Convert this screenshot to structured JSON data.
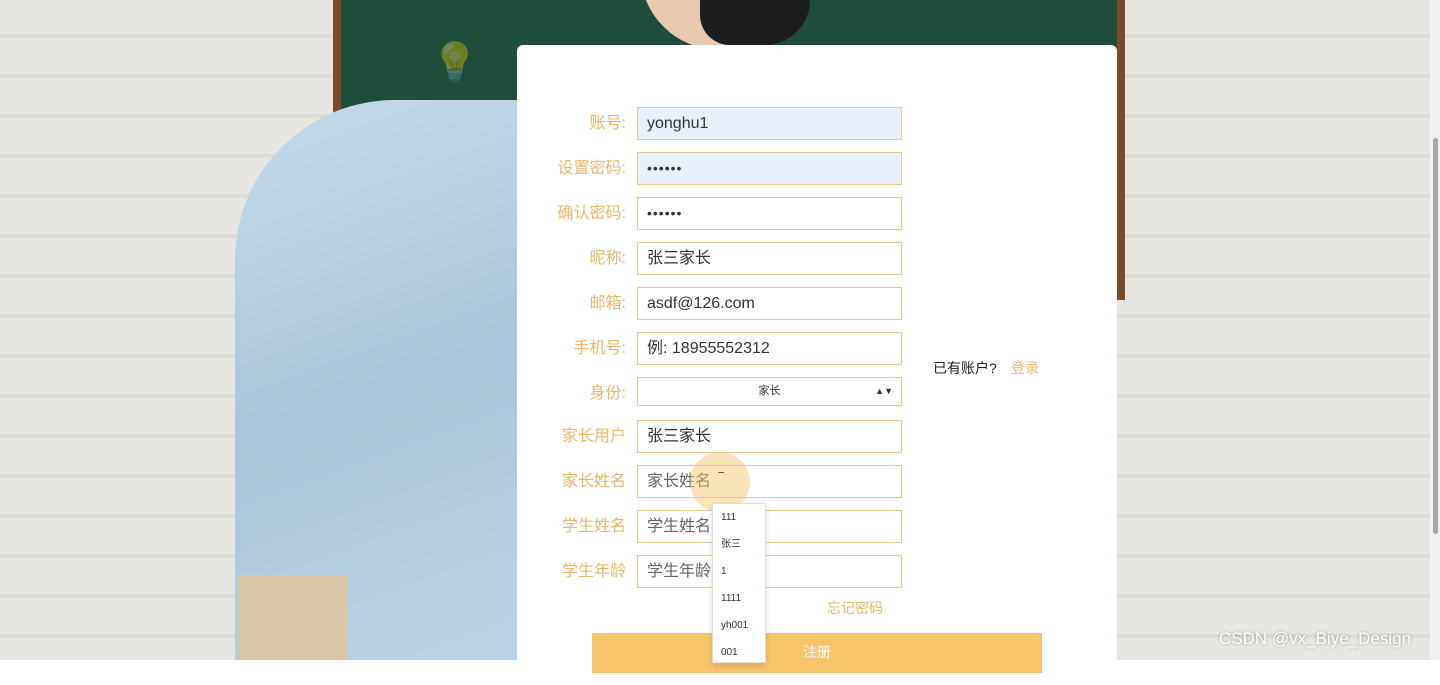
{
  "form": {
    "fields": [
      {
        "label": "账号:",
        "value": "yonghu1"
      },
      {
        "label": "设置密码:",
        "value": "••••••"
      },
      {
        "label": "确认密码:",
        "value": "••••••"
      },
      {
        "label": "昵称:",
        "value": "张三家长"
      },
      {
        "label": "邮箱:",
        "value": "asdf@126.com"
      },
      {
        "label": "手机号:",
        "value": "例: 18955552312"
      },
      {
        "label": "身份:",
        "value": "家长"
      },
      {
        "label": "家长用户",
        "value": "张三家长"
      },
      {
        "label": "家长姓名",
        "placeholder": "家长姓名"
      },
      {
        "label": "学生姓名",
        "placeholder": "学生姓名"
      },
      {
        "label": "学生年龄",
        "placeholder": "学生年龄"
      }
    ],
    "already_have_account": "已有账户?",
    "login_link": "登录",
    "forgot_password": "忘记密码",
    "register_button": "注册"
  },
  "autocomplete": [
    "111",
    "张三",
    "1",
    "1111",
    "yh001",
    "001"
  ],
  "watermark": "CSDN @vx_Biye_Design",
  "colors": {
    "accent": "#e8b86a",
    "button": "#f6c56a",
    "field_border": "#e8c98e"
  }
}
